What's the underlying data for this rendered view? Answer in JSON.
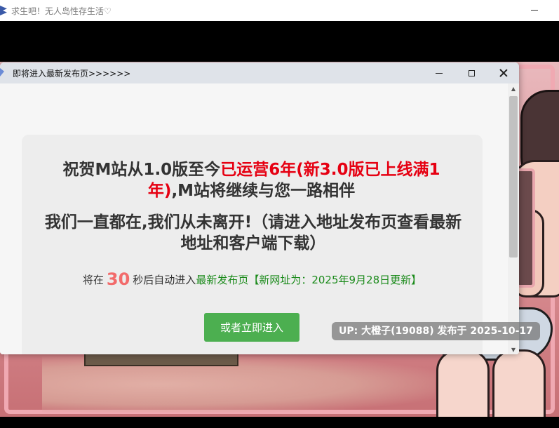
{
  "outer_window": {
    "title": "求生吧！无人岛性存生活♡"
  },
  "popup": {
    "title": "即将进入最新发布页>>>>>>",
    "headline_part1": "祝贺M站从1.0版至今",
    "headline_red": "已运营6年(新3.0版已上线满1年)",
    "headline_part2": ",M站将继续与您一路相伴",
    "subline": "我们一直都在,我们从未离开!（请进入地址发布页查看最新地址和客户端下载）",
    "countdown_prefix": "将在",
    "countdown_seconds": "30",
    "countdown_suffix": "秒后自动进入",
    "countdown_link": "最新发布页【新网址为：2025年9月28日更新】",
    "enter_button_label": "或者立即进入"
  },
  "upload_tag": "UP: 大橙子(19088) 发布于 2025-10-17",
  "colors": {
    "accent_red": "#e60012",
    "countdown_red": "#f26b6b",
    "link_green": "#1a8a1a",
    "button_green": "#4caf50"
  }
}
